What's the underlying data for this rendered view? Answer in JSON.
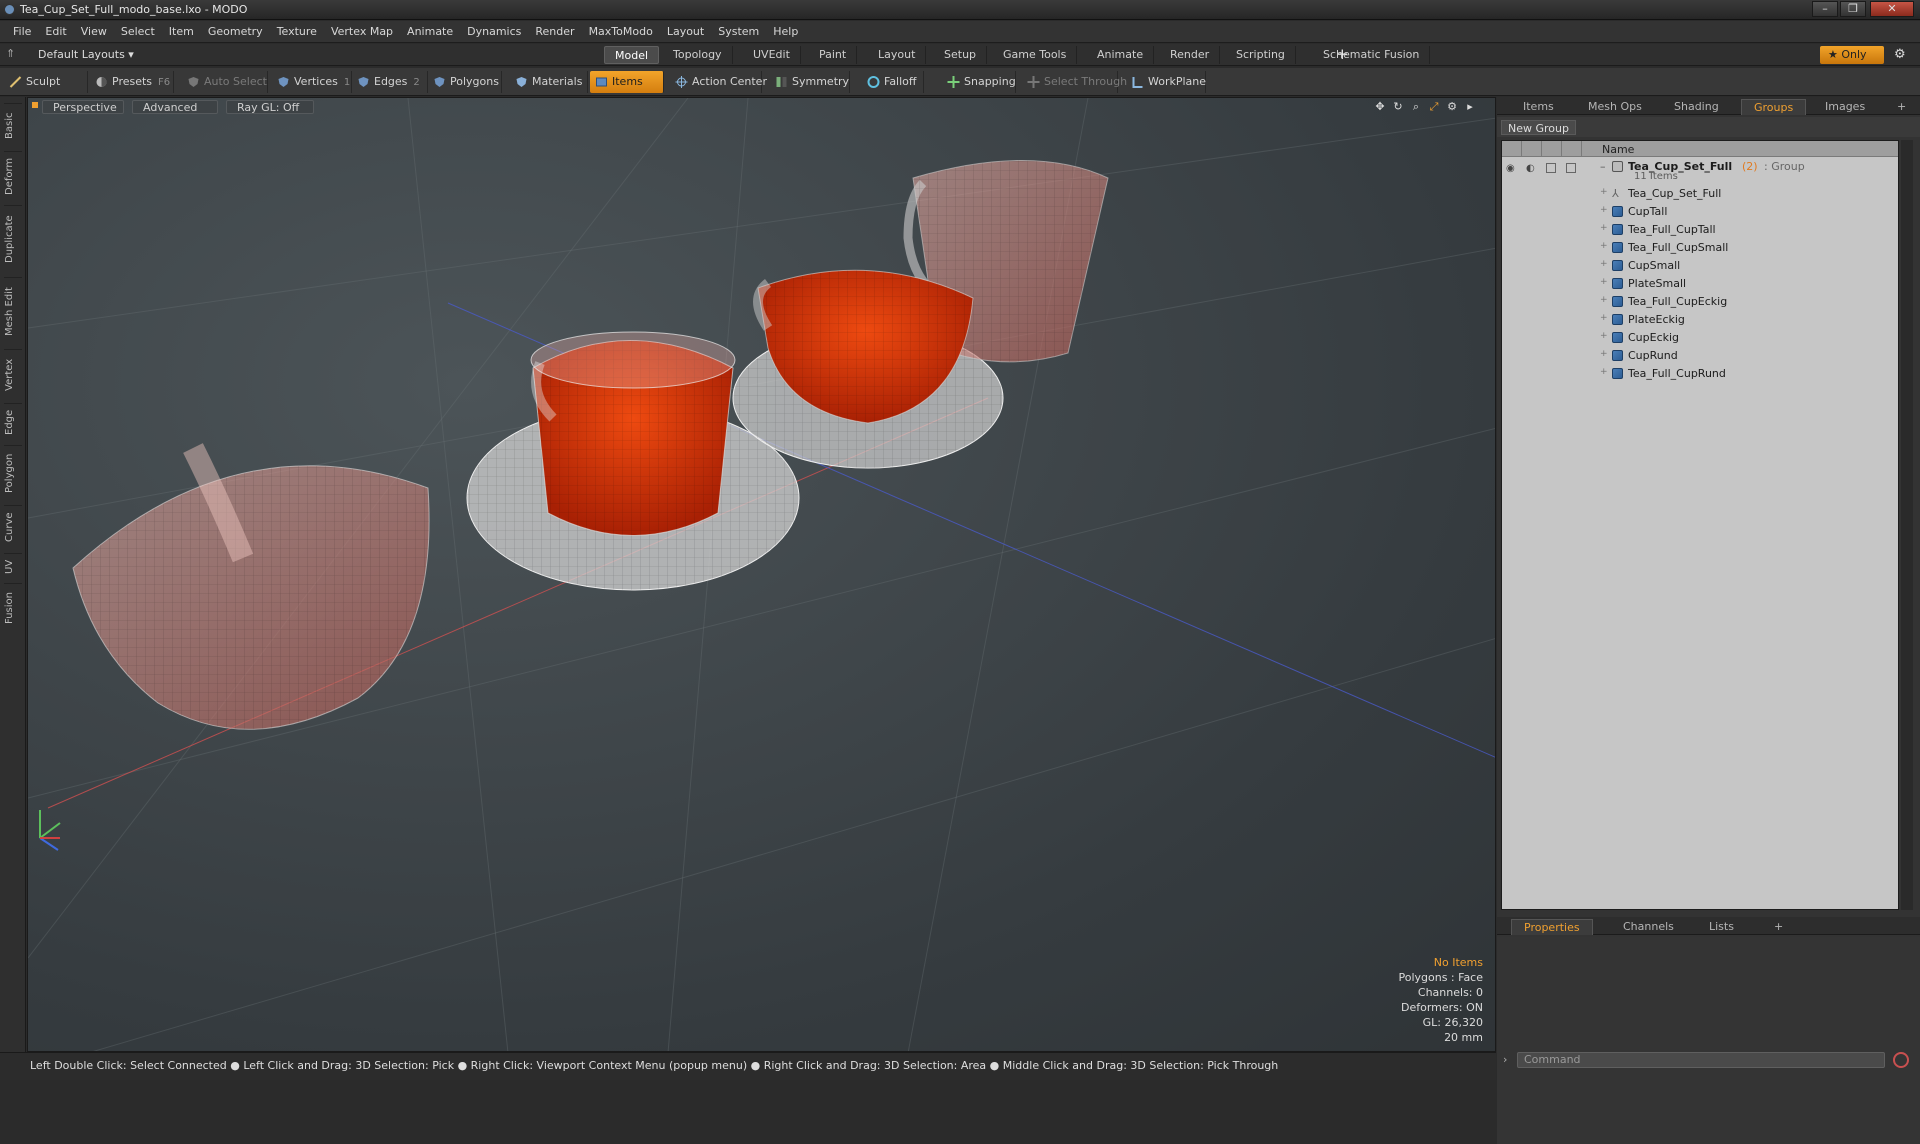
{
  "window": {
    "title": "Tea_Cup_Set_Full_modo_base.lxo - MODO"
  },
  "menu": [
    "File",
    "Edit",
    "View",
    "Select",
    "Item",
    "Geometry",
    "Texture",
    "Vertex Map",
    "Animate",
    "Dynamics",
    "Render",
    "MaxToModo",
    "Layout",
    "System",
    "Help"
  ],
  "layoutbar": {
    "layouts_label": "Default Layouts ▾",
    "tabs": [
      "Model",
      "Topology",
      "UVEdit",
      "Paint",
      "Layout",
      "Setup",
      "Game Tools",
      "Animate",
      "Render",
      "Scripting",
      "Schematic Fusion"
    ],
    "active_tab": "Model",
    "plus": "+",
    "only_label": "Only"
  },
  "toolbar": {
    "sculpt": "Sculpt",
    "presets": "Presets",
    "presets_key": "F6",
    "auto_select": "Auto Select",
    "vertices": "Vertices",
    "vertices_key": "1",
    "edges": "Edges",
    "edges_key": "2",
    "polygons": "Polygons",
    "materials": "Materials",
    "items": "Items",
    "action_center": "Action Center",
    "symmetry": "Symmetry",
    "falloff": "Falloff",
    "snapping": "Snapping",
    "select_through": "Select Through",
    "workplane": "WorkPlane"
  },
  "left_tabs": [
    "Basic",
    "Deform",
    "Duplicate",
    "Mesh Edit",
    "Vertex",
    "Edge",
    "Polygon",
    "Curve",
    "UV",
    "Fusion"
  ],
  "viewport": {
    "view": "Perspective",
    "shading": "Advanced",
    "raygl": "Ray GL: Off",
    "info": {
      "items": "No Items",
      "polygons": "Polygons : Face",
      "channels": "Channels: 0",
      "deformers": "Deformers: ON",
      "gl": "GL: 26,320",
      "scale": "20 mm"
    }
  },
  "status": "Left Double Click: Select Connected ● Left Click and Drag: 3D Selection: Pick ● Right Click: Viewport Context Menu (popup menu) ● Right Click and Drag: 3D Selection: Area ● Middle Click and Drag: 3D Selection: Pick Through",
  "panel": {
    "tabs": [
      "Items",
      "Mesh Ops",
      "Shading",
      "Groups",
      "Images"
    ],
    "active_tab": "Groups",
    "new_group": "New Group",
    "column_name": "Name",
    "group": {
      "name": "Tea_Cup_Set_Full",
      "count": "(2)",
      "type": ": Group",
      "sub": "11 Items"
    },
    "items": [
      "Tea_Cup_Set_Full",
      "CupTall",
      "Tea_Full_CupTall",
      "Tea_Full_CupSmall",
      "CupSmall",
      "PlateSmall",
      "Tea_Full_CupEckig",
      "PlateEckig",
      "CupEckig",
      "CupRund",
      "Tea_Full_CupRund"
    ],
    "item_kinds": [
      "locator",
      "mesh",
      "mesh",
      "mesh",
      "mesh",
      "mesh",
      "mesh",
      "mesh",
      "mesh",
      "mesh",
      "mesh"
    ],
    "bottom_tabs": [
      "Properties",
      "Channels",
      "Lists"
    ],
    "bottom_active": "Properties",
    "command_placeholder": "Command"
  },
  "colors": {
    "accent": "#f0a030",
    "tea": "#c8300a",
    "panel": "#333333"
  }
}
